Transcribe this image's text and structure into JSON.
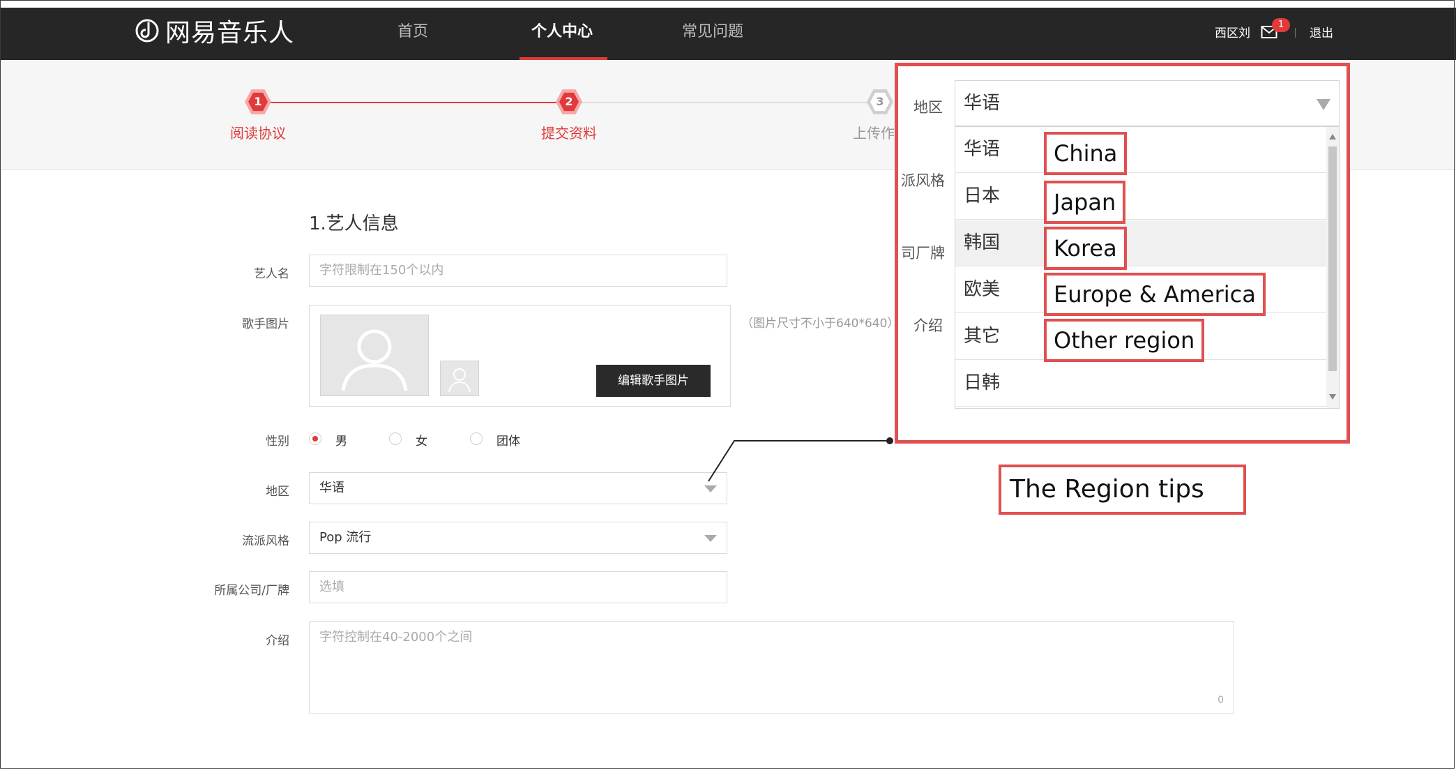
{
  "header": {
    "logo": "网易音乐人",
    "nav": [
      "首页",
      "个人中心",
      "常见问题"
    ],
    "active_nav": "个人中心",
    "user": "西区刘",
    "mail_badge": "1",
    "separator": "|",
    "logout": "退出"
  },
  "steps": [
    {
      "number": "1",
      "label": "阅读协议",
      "state": "done"
    },
    {
      "number": "2",
      "label": "提交资料",
      "state": "current"
    },
    {
      "number": "3",
      "label": "上传作",
      "state": "pending"
    }
  ],
  "form": {
    "section_title": "1.艺人信息",
    "artist_name": {
      "label": "艺人名",
      "placeholder": "字符限制在150个以内"
    },
    "photo": {
      "label": "歌手图片",
      "edit_button": "编辑歌手图片",
      "hint": "（图片尺寸不小于640*640）"
    },
    "gender": {
      "label": "性别",
      "options": [
        "男",
        "女",
        "团体"
      ],
      "selected": "男"
    },
    "region": {
      "label": "地区",
      "value": "华语"
    },
    "genre": {
      "label": "流派风格",
      "value": "Pop 流行"
    },
    "company": {
      "label": "所属公司/厂牌",
      "placeholder": "选填"
    },
    "intro": {
      "label": "介绍",
      "placeholder": "字符控制在40-2000个之间",
      "counter": "0"
    }
  },
  "callout": {
    "labels": [
      "地区",
      "派风格",
      "司厂牌",
      "介绍"
    ],
    "select_value": "华语",
    "options": [
      "华语",
      "日本",
      "韩国",
      "欧美",
      "其它",
      "日韩"
    ],
    "hovered": "韩国",
    "translations": [
      "China",
      "Japan",
      "Korea",
      "Europe & America",
      "Other region"
    ],
    "tips": "The Region tips"
  },
  "colors": {
    "accent": "#e03a3a",
    "header_bg": "#262626",
    "annotation": "#e05050"
  }
}
